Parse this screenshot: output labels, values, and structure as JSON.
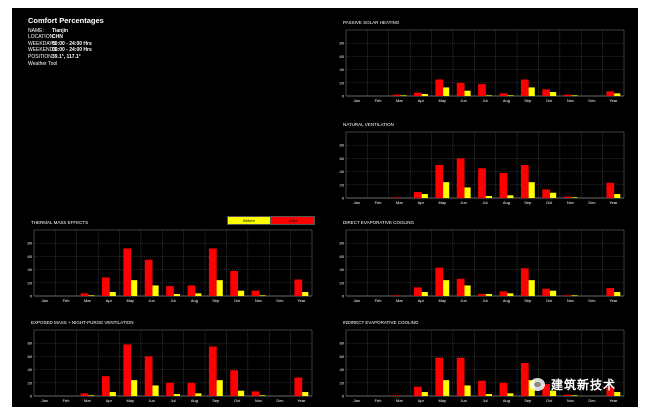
{
  "info": {
    "title": "Comfort Percentages",
    "rows": [
      {
        "k": "NAME:",
        "v": "Tianjin"
      },
      {
        "k": "LOCATION:",
        "v": "CHN"
      },
      {
        "k": "WEEKDAYS:",
        "v": "00:00 - 24:00 Hrs"
      },
      {
        "k": "WEEKENDS:",
        "v": "00:00 - 24:00 Hrs"
      },
      {
        "k": "POSITION:",
        "v": "39.1°, 117.1°"
      }
    ],
    "footer": "Weather Tool"
  },
  "legend": {
    "before_label": "Before",
    "after_label": "After",
    "before_color": "#ffff00",
    "after_color": "#ff0000"
  },
  "watermark": {
    "text": "建筑新技术",
    "icon": "wechat-logo-icon"
  },
  "chart_data": [
    {
      "type": "bar",
      "title": "PASSIVE SOLAR HEATING",
      "categories": [
        "Jan",
        "Feb",
        "Mar",
        "Apr",
        "May",
        "Jun",
        "Jul",
        "Aug",
        "Sep",
        "Oct",
        "Nov",
        "Dec",
        "Year"
      ],
      "y_ticks": [
        "0",
        "20",
        "40",
        "60",
        "80"
      ],
      "ylim": [
        0,
        100
      ],
      "series": [
        {
          "name": "Before",
          "values": [
            0,
            0,
            1,
            3,
            13,
            8,
            1,
            1,
            13,
            6,
            1,
            0,
            4
          ]
        },
        {
          "name": "After",
          "values": [
            0,
            0,
            2,
            5,
            25,
            20,
            18,
            4,
            25,
            10,
            2,
            0,
            7
          ]
        }
      ]
    },
    {
      "type": "bar",
      "title": "NATURAL VENTILATION",
      "categories": [
        "Jan",
        "Feb",
        "Mar",
        "Apr",
        "May",
        "Jun",
        "Jul",
        "Aug",
        "Sep",
        "Oct",
        "Nov",
        "Dec",
        "Year"
      ],
      "y_ticks": [
        "0",
        "20",
        "40",
        "60",
        "80"
      ],
      "ylim": [
        0,
        100
      ],
      "series": [
        {
          "name": "Before",
          "values": [
            0,
            0,
            0,
            6,
            24,
            16,
            3,
            4,
            24,
            8,
            1,
            0,
            6
          ]
        },
        {
          "name": "After",
          "values": [
            0,
            0,
            1,
            9,
            50,
            60,
            45,
            38,
            50,
            13,
            2,
            0,
            23
          ]
        }
      ]
    },
    {
      "type": "bar",
      "title": "THERMAL MASS EFFECTS",
      "categories": [
        "Jan",
        "Feb",
        "Mar",
        "Apr",
        "May",
        "Jun",
        "Jul",
        "Aug",
        "Sep",
        "Oct",
        "Nov",
        "Dec",
        "Year"
      ],
      "y_ticks": [
        "0",
        "20",
        "40",
        "60",
        "80"
      ],
      "ylim": [
        0,
        100
      ],
      "series": [
        {
          "name": "Before",
          "values": [
            0,
            0,
            1,
            6,
            24,
            16,
            3,
            4,
            24,
            8,
            1,
            0,
            6
          ]
        },
        {
          "name": "After",
          "values": [
            0,
            0,
            4,
            28,
            72,
            55,
            15,
            16,
            72,
            38,
            8,
            0,
            25
          ]
        }
      ]
    },
    {
      "type": "bar",
      "title": "DIRECT EVAPORATIVE COOLING",
      "categories": [
        "Jan",
        "Feb",
        "Mar",
        "Apr",
        "May",
        "Jun",
        "Jul",
        "Aug",
        "Sep",
        "Oct",
        "Nov",
        "Dec",
        "Year"
      ],
      "y_ticks": [
        "0",
        "20",
        "40",
        "60",
        "80"
      ],
      "ylim": [
        0,
        100
      ],
      "series": [
        {
          "name": "Before",
          "values": [
            0,
            0,
            0,
            6,
            24,
            16,
            3,
            4,
            24,
            8,
            1,
            0,
            6
          ]
        },
        {
          "name": "After",
          "values": [
            0,
            0,
            1,
            13,
            43,
            26,
            3,
            7,
            42,
            11,
            1,
            0,
            12
          ]
        }
      ]
    },
    {
      "type": "bar",
      "title": "EXPOSED MASS + NIGHT-PURGE VENTILATION",
      "categories": [
        "Jan",
        "Feb",
        "Mar",
        "Apr",
        "May",
        "Jun",
        "Jul",
        "Aug",
        "Sep",
        "Oct",
        "Nov",
        "Dec",
        "Year"
      ],
      "y_ticks": [
        "0",
        "20",
        "40",
        "60",
        "80"
      ],
      "ylim": [
        0,
        100
      ],
      "series": [
        {
          "name": "Before",
          "values": [
            0,
            0,
            1,
            6,
            24,
            16,
            3,
            4,
            24,
            8,
            1,
            0,
            6
          ]
        },
        {
          "name": "After",
          "values": [
            0,
            0,
            4,
            30,
            78,
            60,
            20,
            20,
            75,
            39,
            7,
            0,
            28
          ]
        }
      ]
    },
    {
      "type": "bar",
      "title": "INDIRECT EVAPORATIVE COOLING",
      "categories": [
        "Jan",
        "Feb",
        "Mar",
        "Apr",
        "May",
        "Jun",
        "Jul",
        "Aug",
        "Sep",
        "Oct",
        "Nov",
        "Dec",
        "Year"
      ],
      "y_ticks": [
        "0",
        "20",
        "40",
        "60",
        "80"
      ],
      "ylim": [
        0,
        100
      ],
      "series": [
        {
          "name": "Before",
          "values": [
            0,
            0,
            0,
            6,
            24,
            16,
            3,
            4,
            24,
            8,
            1,
            0,
            6
          ]
        },
        {
          "name": "After",
          "values": [
            0,
            0,
            1,
            14,
            58,
            58,
            23,
            20,
            50,
            18,
            2,
            0,
            14
          ]
        }
      ]
    }
  ]
}
